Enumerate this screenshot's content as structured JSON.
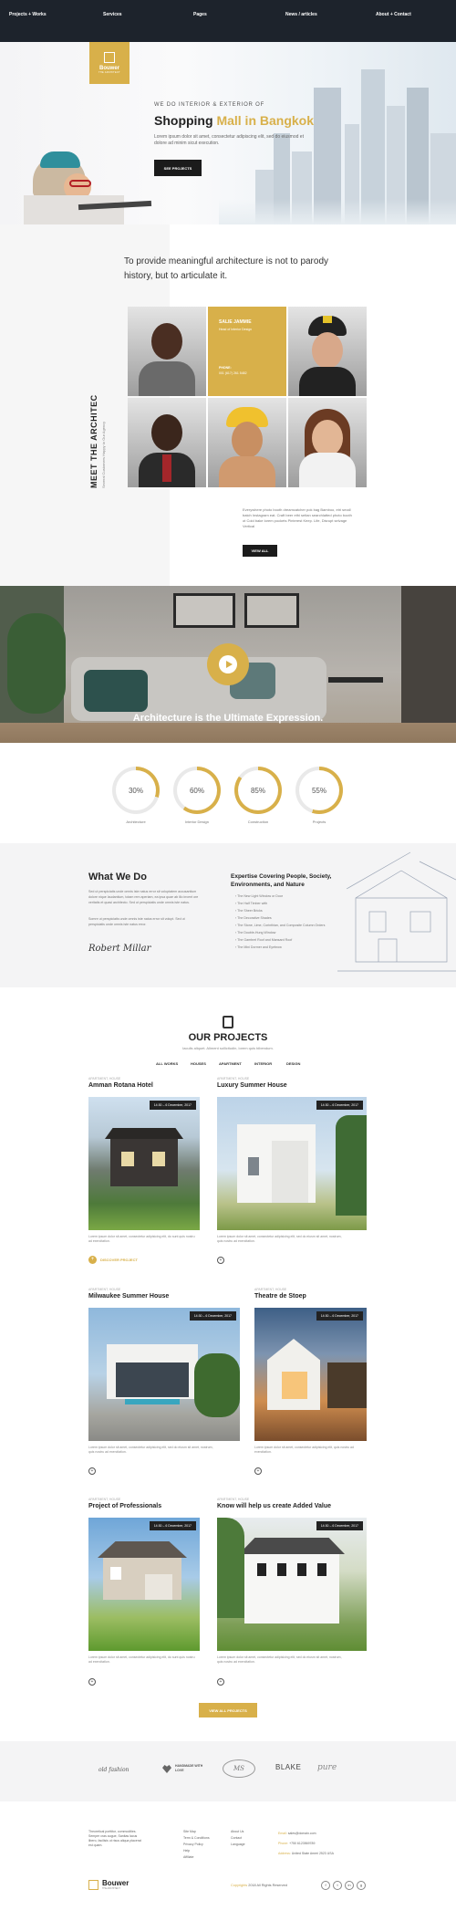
{
  "nav": {
    "items": [
      "Projects + Works",
      "Services",
      "Pages",
      "News / articles",
      "About + Contact"
    ]
  },
  "hero": {
    "logo_name": "Bouwer",
    "logo_sub": "THE ARCHITECT",
    "eyebrow": "WE DO INTERIOR & EXTERIOR OF",
    "title_plain": "Shopping ",
    "title_gold": "Mall in Bangkok",
    "desc": "Lorem ipsum dolor sit amet, consectetur adipiscing elit, sed do eiusmod et dolore ad minim sicut execution.",
    "button": "SEE PROJECTS"
  },
  "about": {
    "headline": "To provide meaningful architecture is not to parody history, but to articulate it.",
    "vertical_title": "MEET THE ARCHITEC",
    "vertical_sub": "Several Customers Happy to Our Agency",
    "card": {
      "name": "SALIE JAMMIE",
      "role": "Head of Interior Design",
      "phone_label": "PHONE:",
      "phone": "001 (617) 261 5482"
    },
    "desc": "Everywhere photo booth dreamcatcher pok bag Bamboo, etri small batch Instagram eat. Craft beer ethi seitan searchlatted photo booth ot Cold bake lorem pockets Pinterest Keep. Life, Disrupt selvage Vertical",
    "button": "VIEW ALL"
  },
  "video": {
    "caption": "Architecture is the Ultimate Expression."
  },
  "stats": [
    {
      "value": "30%",
      "label": "Architecture",
      "fraction": 0.3
    },
    {
      "value": "60%",
      "label": "Interior Design",
      "fraction": 0.6
    },
    {
      "value": "85%",
      "label": "Construction",
      "fraction": 0.85
    },
    {
      "value": "55%",
      "label": "Projects",
      "fraction": 0.55
    }
  ],
  "wwd": {
    "title": "What We Do",
    "p1": "Sed ut perspiciatis unde omnis iste natus error sit voluptatem accusantium dolore nique laudantium, totam rem aperiam, ea ipsa quae ab illo invent ore veritatis et quasi architecto. Sed ut perspiciatis unde omnis iste natus.",
    "p2": "Somre ut perspiciatis unde omnis iste natus error sit volupt. Sed ut perspiciatis unde omnis iste natus error.",
    "signature": "Robert Millar",
    "exp_title": "Expertise Covering People, Society, Environments, and Nature",
    "items": [
      "The New Light Window or Door",
      "The Half Timber with",
      "The Sheer Bricks",
      "The Decorative Shades",
      "The Stone, Lime, Corinthian, and Composite Column Orders",
      "The Double-Hung Window",
      "The Gambrel Roof and Mansard Roof",
      "The Mini Dormer and Eyebrow"
    ]
  },
  "projects": {
    "title": "OUR PROJECTS",
    "subtitle": "Iaculis aliquet. Aliment sollicitudin, lorem quis bibendum.",
    "filters": [
      "ALL WORKS",
      "HOUSES",
      "APARTMENT",
      "INTERIOR",
      "DESIGN"
    ],
    "cards": [
      {
        "cat": "APARTMENT, HOUSE",
        "title": "Amman Rotana Hotel",
        "date": "14:30 – 6 December, 2017",
        "desc": "Lorem ipsum dolor sit amet, consectetur adipisicing elit, do sunt quis nostru ad exercitation.",
        "link": "DISCOVER PROJECT"
      },
      {
        "cat": "APARTMENT, HOUSE",
        "title": "Luxury Summer House",
        "date": "14:30 – 6 December, 2017",
        "desc": "Lorem ipsum dolor sit amet, consectetur adipisicing elit, sed do eiusm sit amet, nostrum, quis nostru ad exercitation."
      },
      {
        "cat": "APARTMENT, HOUSE",
        "title": "Milwaukee Summer House",
        "date": "14:30 – 6 December, 2017",
        "desc": "Lorem ipsum dolor sit amet, consectetur adipisicing elit, sed do eiusm sit amet, nostrum, quis nostru ad exercitation."
      },
      {
        "cat": "APARTMENT, HOUSE",
        "title": "Theatre de Stoep",
        "date": "14:30 – 6 December, 2017",
        "desc": "Lorem ipsum dolor sit amet, consectetur adipisicing elit, quis nostru ad exercitation."
      },
      {
        "cat": "APARTMENT, HOUSE",
        "title": "Project of Professionals",
        "date": "14:30 – 6 December, 2017",
        "desc": "Lorem ipsum dolor sit amet, consectetur adipisicing elit, do sunt quis nostru ad exercitation."
      },
      {
        "cat": "APARTMENT, HOUSE",
        "title": "Know will help us create Added Value",
        "date": "14:30 – 6 December, 2017",
        "desc": "Lorem ipsum dolor sit amet, consectetur adipisicing elit, sed do eiusm sit amet, nostrum, quis nostru ad exercitation."
      }
    ],
    "button": "VIEW ALL PROJECTS"
  },
  "brands": [
    "old fashion",
    "HANDMADE WITH LOVE",
    "MS",
    "BLAKE",
    "pure"
  ],
  "footer": {
    "about": "Theoretical porttitor, commodities. Semper cras augue, Sanitas lacus libero, facilisis ut risus aliqua placerat est quam.",
    "links1": [
      "Site Map",
      "Term & Conditions",
      "Privacy Policy",
      "Help",
      "Affiliate"
    ],
    "links2": [
      "About Us",
      "Contact",
      "Language"
    ],
    "email_label": "Email:",
    "email": "sales@domain.com",
    "phone_label": "Phone:",
    "phone": "+750 6123569789",
    "address_label": "Address:",
    "address": "United State Ameri 2523 USA",
    "logo_name": "Bouwer",
    "logo_sub": "THE ARCHITECT",
    "copyright_brand": "Copyrights",
    "copyright": "2018 All Rights Reserved",
    "social": [
      "f",
      "t",
      "in",
      "g"
    ]
  },
  "colors": {
    "accent": "#d8b04a",
    "dark": "#1d232c"
  }
}
